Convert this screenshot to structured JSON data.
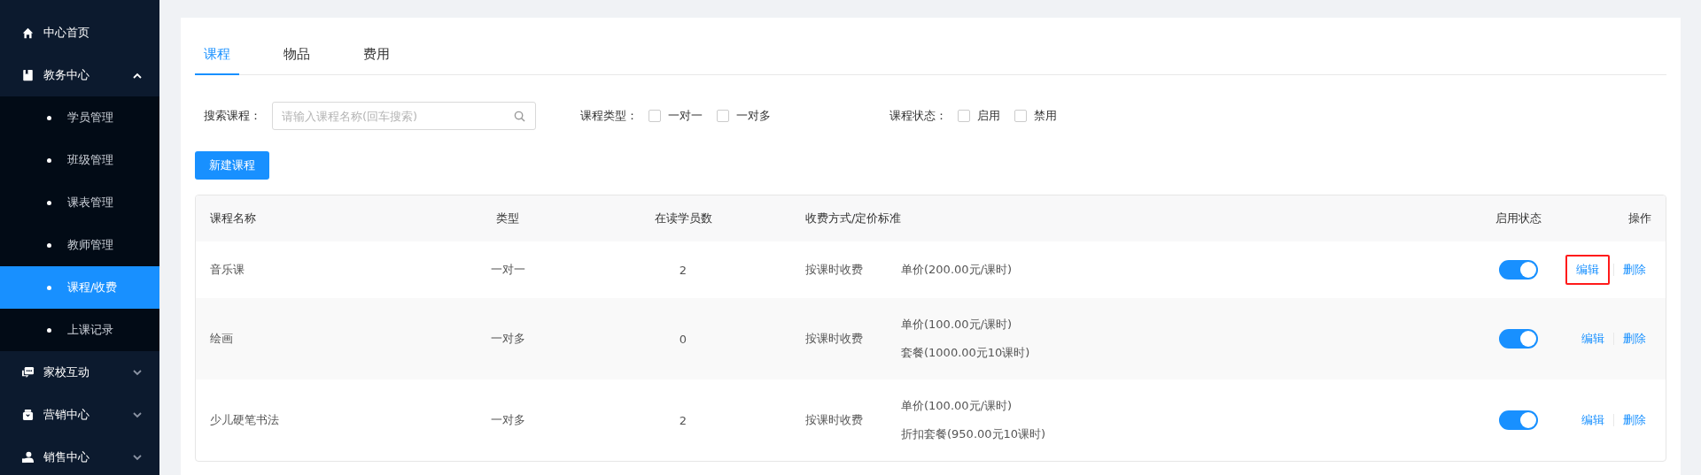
{
  "sidebar": {
    "items": [
      {
        "label": "中心首页",
        "kind": "link"
      },
      {
        "label": "教务中心",
        "kind": "group",
        "expanded": true,
        "children": [
          {
            "label": "学员管理",
            "selected": false
          },
          {
            "label": "班级管理",
            "selected": false
          },
          {
            "label": "课表管理",
            "selected": false
          },
          {
            "label": "教师管理",
            "selected": false
          },
          {
            "label": "课程/收费",
            "selected": true
          },
          {
            "label": "上课记录",
            "selected": false
          }
        ]
      },
      {
        "label": "家校互动",
        "kind": "group",
        "expanded": false
      },
      {
        "label": "营销中心",
        "kind": "group",
        "expanded": false
      },
      {
        "label": "销售中心",
        "kind": "group",
        "expanded": false
      }
    ]
  },
  "tabs": [
    {
      "label": "课程",
      "selected": true
    },
    {
      "label": "物品",
      "selected": false
    },
    {
      "label": "费用",
      "selected": false
    }
  ],
  "filters": {
    "search_label": "搜索课程：",
    "search": {
      "placeholder": "请输入课程名称(回车搜索)"
    },
    "type_label": "课程类型：",
    "type_options": [
      {
        "label": "一对一",
        "checked": false
      },
      {
        "label": "一对多",
        "checked": false
      }
    ],
    "status_label": "课程状态：",
    "status_options": [
      {
        "label": "启用",
        "checked": false
      },
      {
        "label": "禁用",
        "checked": false
      }
    ]
  },
  "new_button": "新建课程",
  "table": {
    "columns": [
      "课程名称",
      "类型",
      "在读学员数",
      "收费方式/定价标准",
      "启用状态",
      "操作"
    ],
    "rows": [
      {
        "name": "音乐课",
        "type": "一对一",
        "students": "2",
        "method": "按课时收费",
        "prices": [
          "单价(200.00元/课时)"
        ],
        "enabled": true,
        "edit": "编辑",
        "delete": "删除",
        "highlighted": true
      },
      {
        "name": "绘画",
        "type": "一对多",
        "students": "0",
        "method": "按课时收费",
        "prices": [
          "单价(100.00元/课时)",
          "套餐(1000.00元10课时)"
        ],
        "enabled": true,
        "edit": "编辑",
        "delete": "删除",
        "highlighted": false
      },
      {
        "name": "少儿硬笔书法",
        "type": "一对多",
        "students": "2",
        "method": "按课时收费",
        "prices": [
          "单价(100.00元/课时)",
          "折扣套餐(950.00元10课时)"
        ],
        "enabled": true,
        "edit": "编辑",
        "delete": "删除",
        "highlighted": false
      }
    ]
  }
}
